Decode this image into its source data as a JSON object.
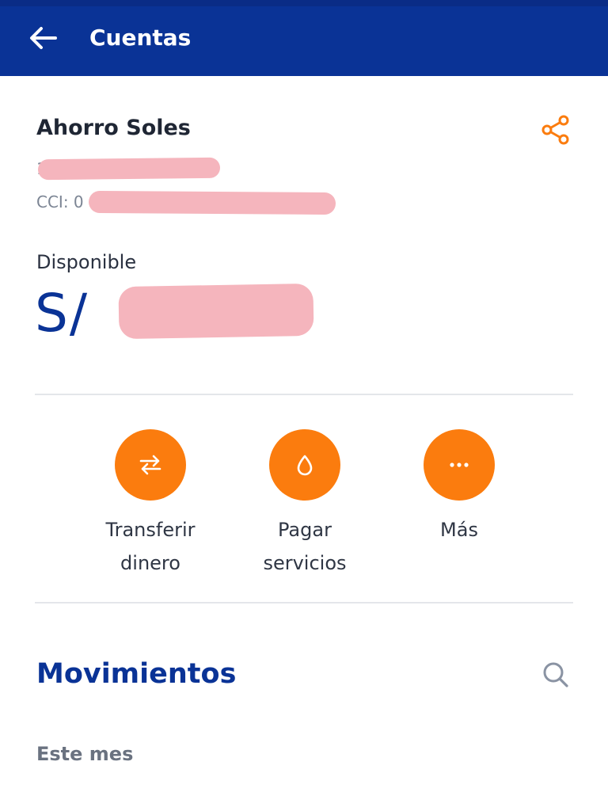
{
  "header": {
    "title": "Cuentas",
    "back_icon": "arrow-left-icon",
    "background": "#0a3396"
  },
  "account": {
    "name": "Ahorro Soles",
    "number_visible": "1",
    "cci_label": "CCI: 0",
    "share_icon": "share-icon",
    "available_label": "Disponible",
    "currency_symbol": "S/",
    "amount_visible": "3"
  },
  "actions": [
    {
      "label": "Transferir\ndinero",
      "icon": "transfer-arrows-icon"
    },
    {
      "label": "Pagar\nservicios",
      "icon": "droplet-icon"
    },
    {
      "label": "Más",
      "icon": "more-dots-icon"
    }
  ],
  "movements": {
    "title": "Movimientos",
    "search_icon": "search-icon",
    "period_label": "Este mes"
  },
  "colors": {
    "accent": "#fb7c0e",
    "brand": "#0a3396"
  }
}
